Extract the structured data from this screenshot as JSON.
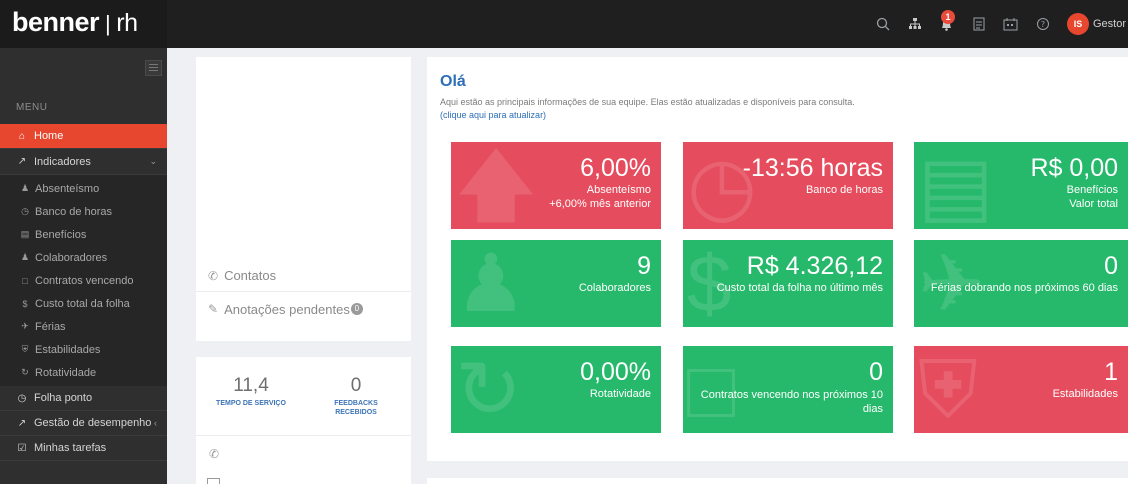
{
  "brand": {
    "name": "benner",
    "separator": "|",
    "product": "rh"
  },
  "topbar": {
    "icons": [
      "search-icon",
      "org-chart-icon",
      "bell-icon",
      "report-icon",
      "calendar-icon",
      "help-icon"
    ],
    "notification_count": "1",
    "user": {
      "initials": "IS",
      "name": "Gestor"
    }
  },
  "sidebar": {
    "menu_label": "MENU",
    "home": "Home",
    "indicadores": "Indicadores",
    "sub_items": [
      {
        "label": "Absenteísmo",
        "icon": "users-icon"
      },
      {
        "label": "Banco de horas",
        "icon": "clock-icon"
      },
      {
        "label": "Benefícios",
        "icon": "card-icon"
      },
      {
        "label": "Colaboradores",
        "icon": "group-icon"
      },
      {
        "label": "Contratos vencendo",
        "icon": "file-icon"
      },
      {
        "label": "Custo total da folha",
        "icon": "dollar-icon"
      },
      {
        "label": "Férias",
        "icon": "plane-icon"
      },
      {
        "label": "Estabilidades",
        "icon": "shield-icon"
      },
      {
        "label": "Rotatividade",
        "icon": "refresh-icon"
      }
    ],
    "folha_ponto": "Folha ponto",
    "gestao": "Gestão de desempenho",
    "tarefas": "Minhas tarefas"
  },
  "left_panel": {
    "contatos": "Contatos",
    "anotacoes": "Anotações pendentes",
    "anotacoes_count": "0"
  },
  "stats": {
    "tempo_valor": "11,4",
    "tempo_label": "TEMPO DE SERVIÇO",
    "feedbacks_valor": "0",
    "feedbacks_label_1": "FEEDBACKS",
    "feedbacks_label_2": "RECEBIDOS"
  },
  "main": {
    "greeting": "Olá",
    "subtitle": "Aqui estão as principais informações de sua equipe. Elas estão atualizadas e disponíveis para consulta.",
    "refresh_link": "(clique aqui para atualizar)"
  },
  "tiles": {
    "absenteismo": {
      "value": "6,00%",
      "line1": "Absenteísmo",
      "line2": "+6,00% mês anterior",
      "color": "#e54c5d"
    },
    "banco_horas": {
      "value": "-13:56 horas",
      "line1": "Banco de horas",
      "color": "#e54c5d"
    },
    "beneficios": {
      "value": "R$ 0,00",
      "line1": "Benefícios",
      "line2": "Valor total",
      "color": "#26b96b"
    },
    "colaboradores": {
      "value": "9",
      "line1": "Colaboradores",
      "color": "#26b96b"
    },
    "custo_folha": {
      "value": "R$ 4.326,12",
      "line1": "Custo total da folha no último mês",
      "color": "#26b96b"
    },
    "ferias": {
      "value": "0",
      "line1": "Férias dobrando nos próximos 60 dias",
      "color": "#26b96b"
    },
    "rotatividade": {
      "value": "0,00%",
      "line1": "Rotatividade",
      "color": "#26b96b"
    },
    "contratos": {
      "value": "0",
      "line1": "Contratos vencendo nos próximos 10 dias",
      "color": "#26b96b"
    },
    "estabilidades": {
      "value": "1",
      "line1": "Estabilidades",
      "color": "#e54c5d"
    }
  }
}
